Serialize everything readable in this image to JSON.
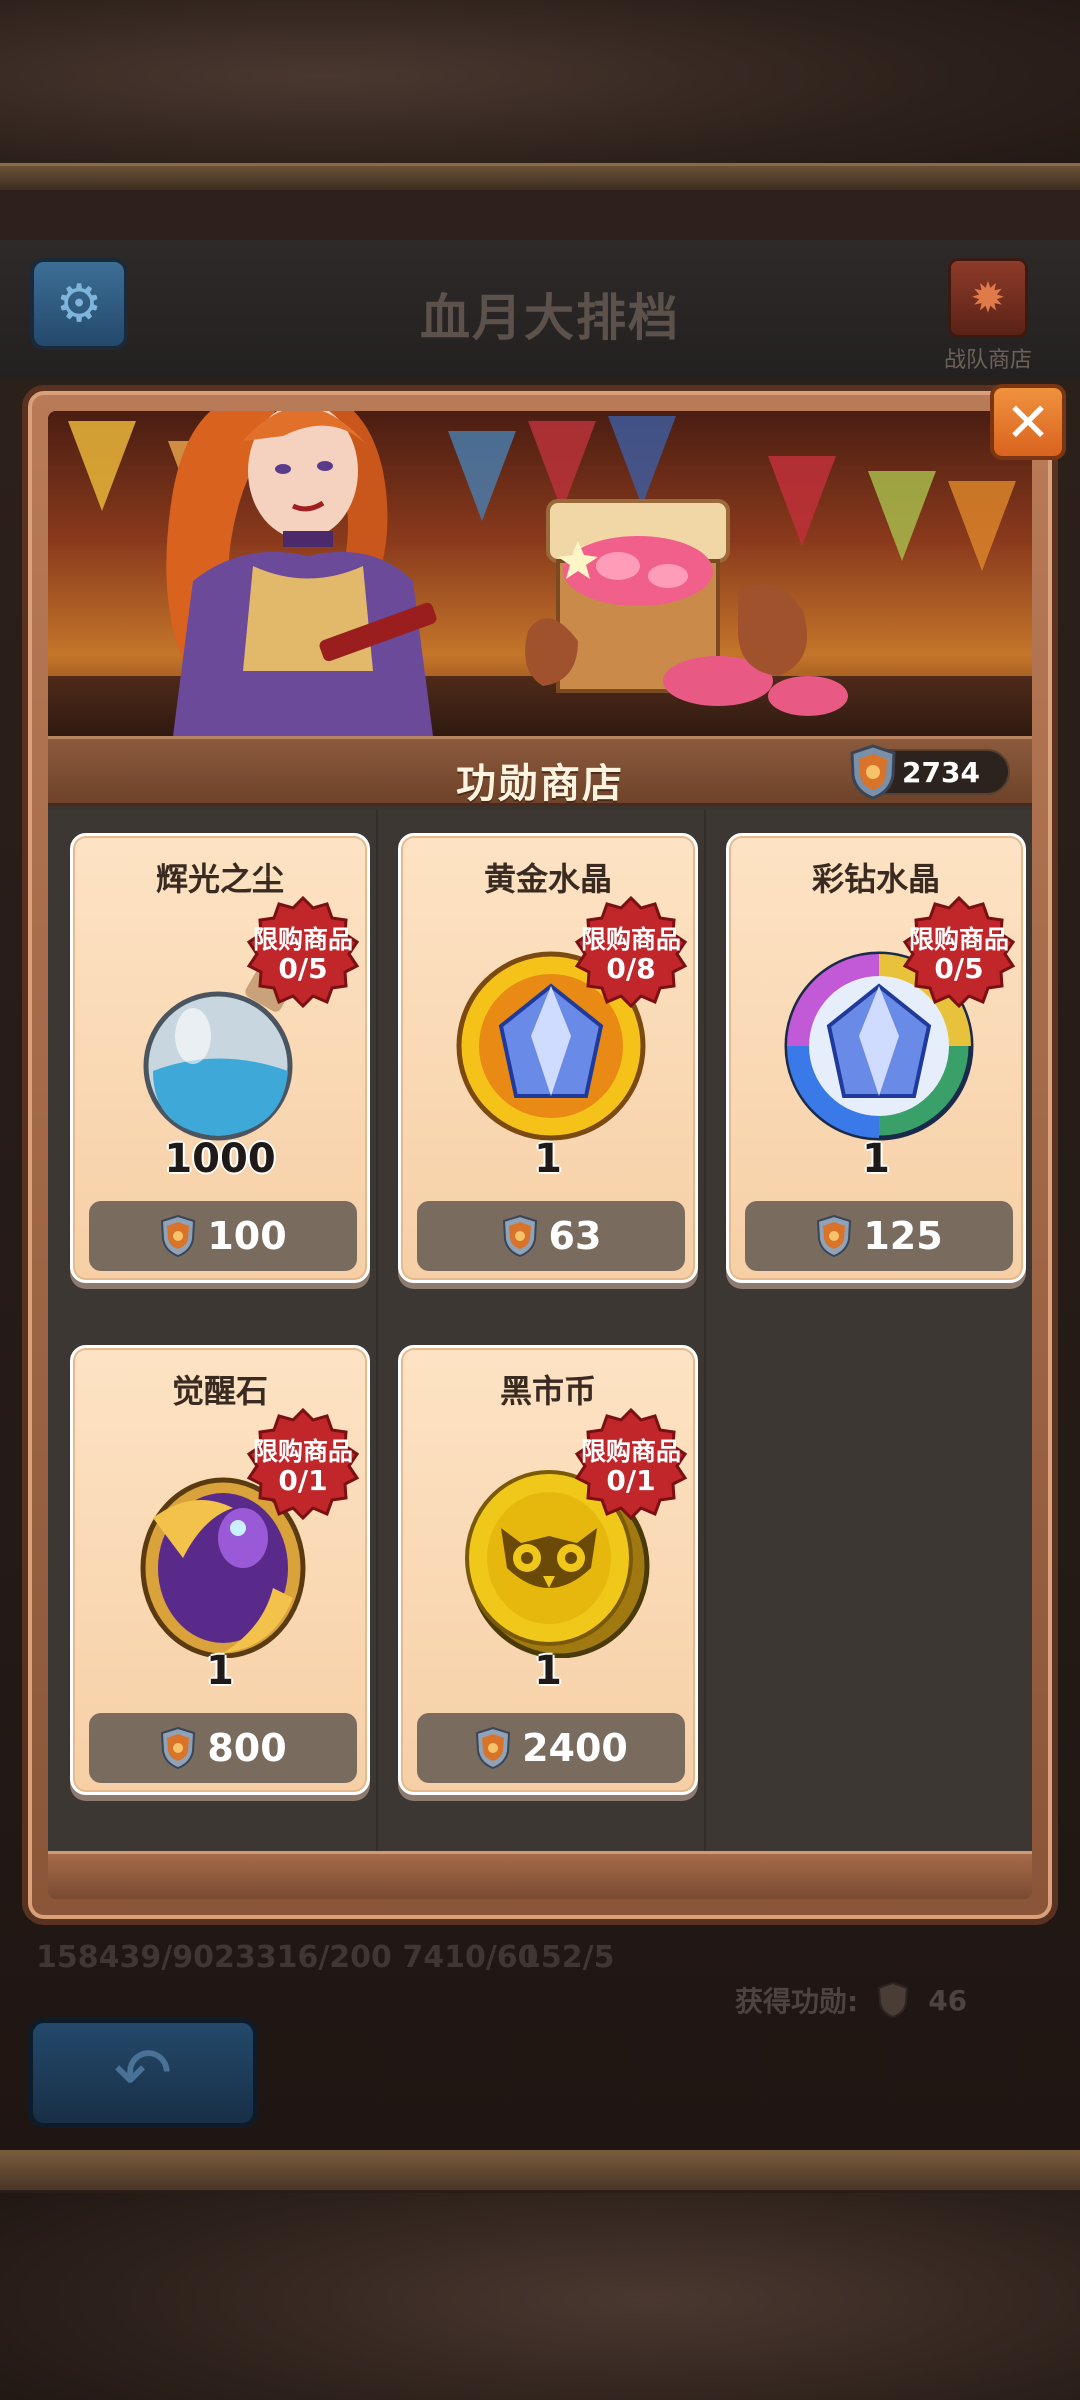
{
  "page": {
    "title": "血月大排档",
    "team_shop_label": "战队商店",
    "stats_left": "158439/9023316/200 7410/60",
    "stats_right": "152/5",
    "earned_label": "获得功勋:",
    "earned_value": "46"
  },
  "modal": {
    "shop_title": "功勋商店",
    "currency_value": "2734",
    "badge_label": "限购商品",
    "items": [
      {
        "name": "辉光之尘",
        "limit": "0/5",
        "quantity": "1000",
        "price": "100",
        "icon": "dust-flask-icon"
      },
      {
        "name": "黄金水晶",
        "limit": "0/8",
        "quantity": "1",
        "price": "63",
        "icon": "gold-crystal-icon"
      },
      {
        "name": "彩钻水晶",
        "limit": "0/5",
        "quantity": "1",
        "price": "125",
        "icon": "rainbow-crystal-icon"
      },
      {
        "name": "觉醒石",
        "limit": "0/1",
        "quantity": "1",
        "price": "800",
        "icon": "awakening-stone-icon"
      },
      {
        "name": "黑市币",
        "limit": "0/1",
        "quantity": "1",
        "price": "2400",
        "icon": "black-market-coin-icon"
      }
    ]
  },
  "icons": {
    "settings": "gear-icon",
    "close": "close-icon",
    "back": "back-arrow-icon",
    "currency": "medal-shield-icon"
  },
  "colors": {
    "modal_frame": "#b97b57",
    "card_bg": "#fde3c4",
    "price_bg": "#7a6b5f",
    "badge_red": "#c0262a",
    "close_orange": "#f0923e"
  }
}
